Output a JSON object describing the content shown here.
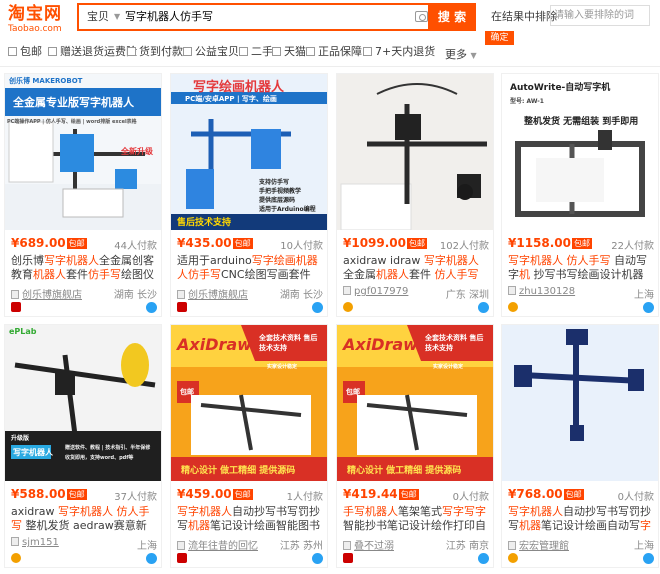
{
  "header": {
    "logo_main": "淘宝网",
    "logo_sub": "Taobao.com",
    "scope": "宝贝",
    "query": "写字机器人仿手写",
    "search_label": "搜 索",
    "refine_label": "在结果中排除",
    "refine_placeholder": "请输入要排除的词",
    "confirm_label": "确定"
  },
  "filters": [
    "包邮",
    "赠送退货运费险",
    "货到付款",
    "公益宝贝",
    "二手",
    "天猫",
    "正品保障",
    "7+天内退货"
  ],
  "more_label": "更多",
  "products": [
    {
      "price": "¥689.00",
      "tag": "包邮",
      "sales": "44人付款",
      "title_segments": [
        {
          "t": "创乐博",
          "h": false
        },
        {
          "t": "写字机器人",
          "h": true
        },
        {
          "t": "全金属创客教育",
          "h": false
        },
        {
          "t": "机器人",
          "h": true
        },
        {
          "t": "套件",
          "h": false
        },
        {
          "t": "仿手写",
          "h": true
        },
        {
          "t": "绘图仪word排版",
          "h": false
        }
      ],
      "shop": "创乐博旗舰店",
      "location": "湖南 长沙",
      "img": {
        "top_left": "创乐博 MAKEROBOT",
        "band_title": "全金属专业版写字机器人",
        "sub": "PC端操作APP | 仿人手写、绘画 | word排版 excel表格",
        "upgrade": "全新升级"
      },
      "badge": "tmall"
    },
    {
      "price": "¥435.00",
      "tag": "包邮",
      "sales": "10人付款",
      "title_segments": [
        {
          "t": "适用于arduino",
          "h": false
        },
        {
          "t": "写字绘画机器人",
          "h": true
        },
        {
          "t": "仿手写",
          "h": true
        },
        {
          "t": "CNC绘图写画套件STEAM教育",
          "h": false
        }
      ],
      "shop": "创乐博旗舰店",
      "location": "湖南 长沙",
      "img": {
        "headline": "写字绘画机器人",
        "subline": "PC端/安卓APP | 写字、绘画",
        "features": [
          "支持仿手写",
          "手把手视频教学",
          "提供底层源码",
          "适用于Arduino编程"
        ],
        "footer": "售后技术支持"
      },
      "badge": "tmall"
    },
    {
      "price": "¥1099.00",
      "tag": "包邮",
      "sales": "102人付款",
      "title_segments": [
        {
          "t": "axidraw idraw ",
          "h": false
        },
        {
          "t": "写字机器人",
          "h": true
        },
        {
          "t": " 全金属",
          "h": false
        },
        {
          "t": "机器人",
          "h": true
        },
        {
          "t": "套件 ",
          "h": false
        },
        {
          "t": "仿人手写",
          "h": true
        }
      ],
      "shop": "pgf017979",
      "location": "广东 深圳",
      "img": {},
      "badge": "gold"
    },
    {
      "price": "¥1158.00",
      "tag": "包邮",
      "sales": "22人付款",
      "title_segments": [
        {
          "t": "写字机器人",
          "h": true
        },
        {
          "t": " ",
          "h": false
        },
        {
          "t": "仿人手写",
          "h": true
        },
        {
          "t": " 自动写字",
          "h": false
        },
        {
          "t": "机",
          "h": true
        },
        {
          "t": " 抄写书写绘画设计机器人写字",
          "h": false
        }
      ],
      "shop": "zhu130128",
      "location": "上海",
      "img": {
        "title": "AutoWrite-自动写字机",
        "model": "型号: AW-1",
        "slogan": "整机发货 无需组装 到手即用"
      },
      "badge": "gold"
    },
    {
      "price": "¥588.00",
      "tag": "包邮",
      "sales": "37人付款",
      "title_segments": [
        {
          "t": "axidraw ",
          "h": false
        },
        {
          "t": "写字机器人",
          "h": true
        },
        {
          "t": " 仿人手写",
          "h": true
        },
        {
          "t": " 整机发货 aedraw赛意新",
          "h": false
        }
      ],
      "shop": "sjm151",
      "location": "上海",
      "img": {
        "brand": "ePLab",
        "badge": "升级版",
        "band_title": "写字机器人",
        "lines": [
          "赠送软件、教程 | 技术指引、半年保修",
          "收货即用，支持word、pdf等"
        ]
      },
      "badge": "gold"
    },
    {
      "price": "¥459.00",
      "tag": "包邮",
      "sales": "1人付款",
      "title_segments": [
        {
          "t": "写字机器人",
          "h": true
        },
        {
          "t": "自动抄写书写罚抄写",
          "h": false
        },
        {
          "t": "机器",
          "h": true
        },
        {
          "t": "笔记设计绘画智能图书",
          "h": false
        }
      ],
      "shop": "流年往昔的回忆",
      "location": "江苏 苏州",
      "img": {
        "brand": "AxiDraw",
        "banner": "全套技术资料 售后技术支持",
        "ribbon": "实家设计稳定",
        "corner": "包邮",
        "footer": "精心设计 做工精细 提供源码"
      },
      "badge": "tmall"
    },
    {
      "price": "¥419.44",
      "tag": "包邮",
      "sales": "0人付款",
      "title_segments": [
        {
          "t": "手写机器人",
          "h": true
        },
        {
          "t": "笔架笔式",
          "h": false
        },
        {
          "t": "写字写字",
          "h": true
        },
        {
          "t": "智能抄书笔记设计绘作打印自动罚写高精",
          "h": false
        }
      ],
      "shop": "叠不过溺",
      "location": "江苏 南京",
      "img": {
        "brand": "AxiDraw",
        "banner": "全套技术资料 售后技术支持",
        "ribbon": "实家设计稳定",
        "corner": "包邮",
        "footer": "精心设计 做工精细 提供源码"
      },
      "badge": "tmall"
    },
    {
      "price": "¥768.00",
      "tag": "包邮",
      "sales": "0人付款",
      "title_segments": [
        {
          "t": "写字机器人",
          "h": true
        },
        {
          "t": "自动抄写书写罚抄写",
          "h": false
        },
        {
          "t": "机器",
          "h": true
        },
        {
          "t": "笔记设计绘画自动写",
          "h": false
        },
        {
          "t": "字",
          "h": true
        }
      ],
      "shop": "宏宏管理館",
      "location": "上海",
      "img": {},
      "badge": "gold"
    }
  ]
}
